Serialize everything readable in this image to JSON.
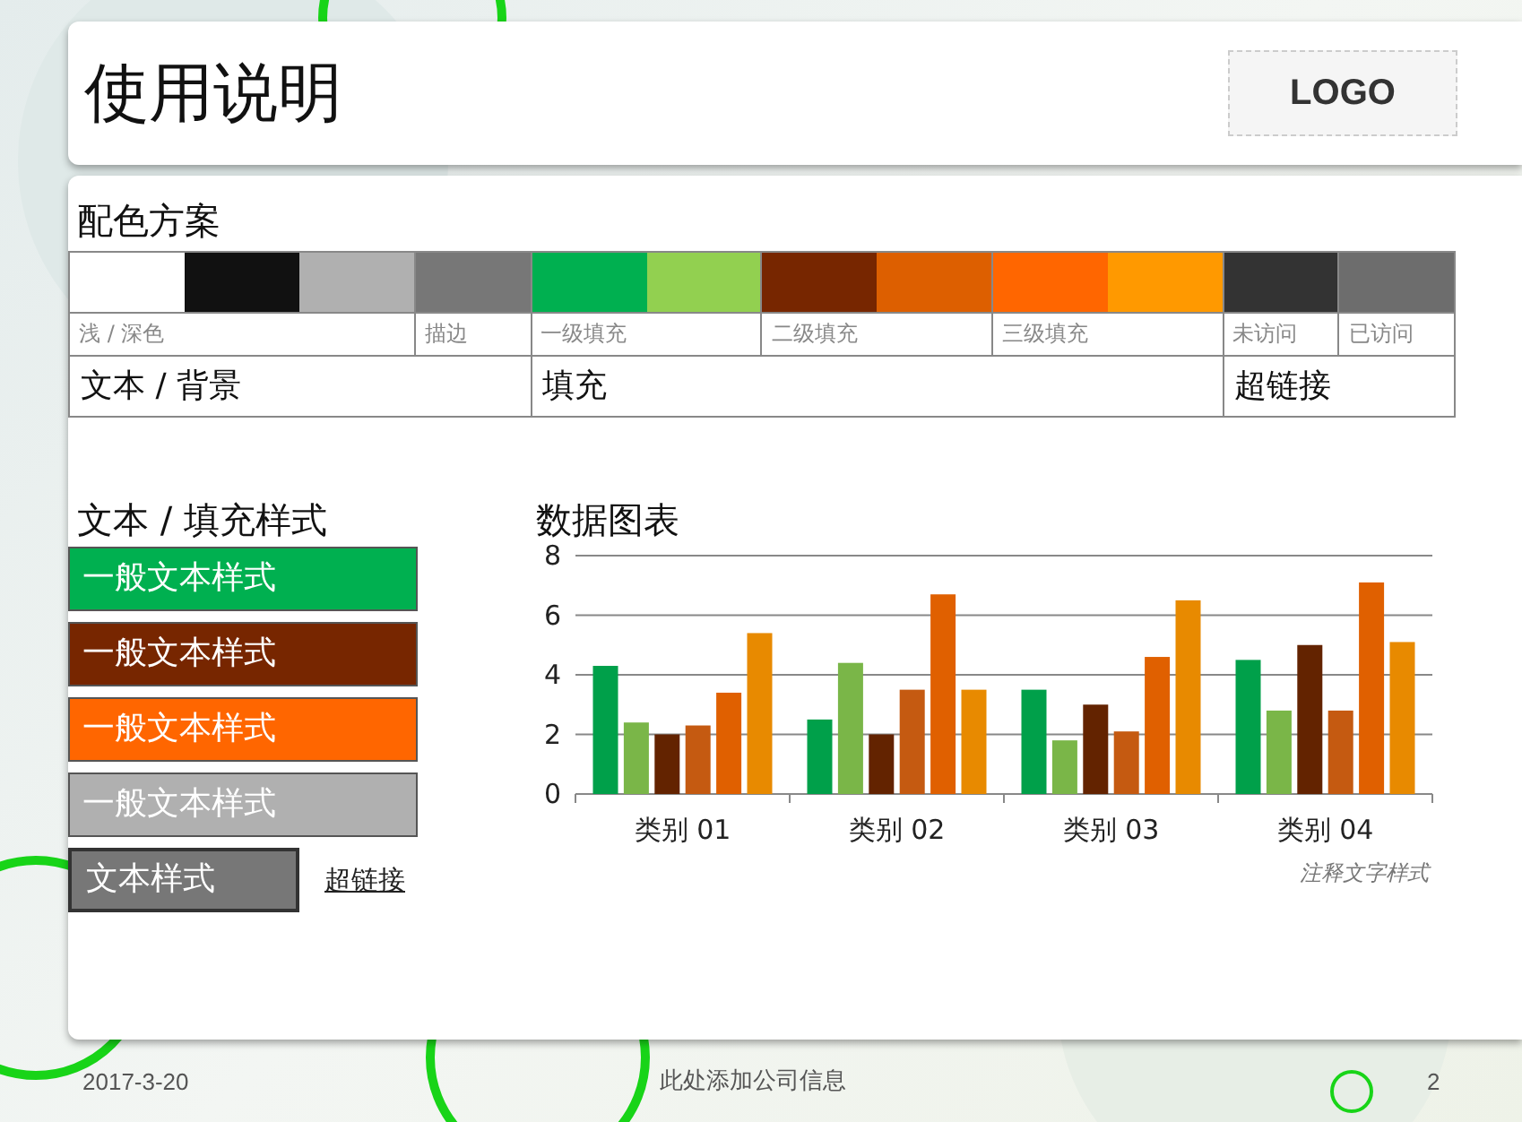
{
  "header": {
    "title": "使用说明",
    "logo": "LOGO"
  },
  "palette": {
    "title": "配色方案",
    "sections": [
      {
        "label": "文本 / 背景",
        "groups": [
          {
            "label": "浅 / 深色",
            "swatches": [
              {
                "color": "#ffffff"
              },
              {
                "color": "#111111"
              },
              {
                "color": "#b0b0b0"
              }
            ]
          },
          {
            "label": "描边",
            "swatches": [
              {
                "color": "#777777"
              }
            ]
          }
        ]
      },
      {
        "label": "填充",
        "groups": [
          {
            "label": "一级填充",
            "swatches": [
              {
                "color": "#00b050"
              },
              {
                "color": "#92d050"
              }
            ]
          },
          {
            "label": "二级填充",
            "swatches": [
              {
                "color": "#772600"
              },
              {
                "color": "#dd5f00"
              }
            ]
          },
          {
            "label": "三级填充",
            "swatches": [
              {
                "color": "#ff6600"
              },
              {
                "color": "#ff9900"
              }
            ]
          }
        ]
      },
      {
        "label": "超链接",
        "groups": [
          {
            "label": "未访问",
            "swatches": [
              {
                "color": "#333333"
              }
            ]
          },
          {
            "label": "已访问",
            "swatches": [
              {
                "color": "#6d6d6d"
              }
            ]
          }
        ]
      }
    ]
  },
  "styles": {
    "title": "文本 / 填充样式",
    "fills": [
      {
        "text": "一般文本样式",
        "color": "#00b050"
      },
      {
        "text": "一般文本样式",
        "color": "#772600"
      },
      {
        "text": "一般文本样式",
        "color": "#ff6600"
      },
      {
        "text": "一般文本样式",
        "color": "#b0b0b0"
      }
    ],
    "text_style": {
      "text": "文本样式",
      "color": "#777777"
    },
    "link": "超链接"
  },
  "chart": {
    "title": "数据图表",
    "note": "注释文字样式",
    "chart_data": {
      "type": "bar",
      "categories": [
        "类别 01",
        "类别 02",
        "类别 03",
        "类别 04"
      ],
      "ylim": [
        0,
        8
      ],
      "grid": true,
      "yticks": [
        0,
        2,
        4,
        6,
        8
      ],
      "series": [
        {
          "color": "#00a04a",
          "values": [
            4.3,
            2.5,
            3.5,
            4.5
          ]
        },
        {
          "color": "#7ab648",
          "values": [
            2.4,
            4.4,
            1.8,
            2.8
          ]
        },
        {
          "color": "#632300",
          "values": [
            2.0,
            2.0,
            3.0,
            5.0
          ]
        },
        {
          "color": "#c55a11",
          "values": [
            2.3,
            3.5,
            2.1,
            2.8
          ]
        },
        {
          "color": "#e06000",
          "values": [
            3.4,
            6.7,
            4.6,
            7.1
          ]
        },
        {
          "color": "#e88a00",
          "values": [
            5.4,
            3.5,
            6.5,
            5.1
          ]
        }
      ]
    }
  },
  "footer": {
    "date": "2017-3-20",
    "company": "此处添加公司信息",
    "page": "2"
  }
}
